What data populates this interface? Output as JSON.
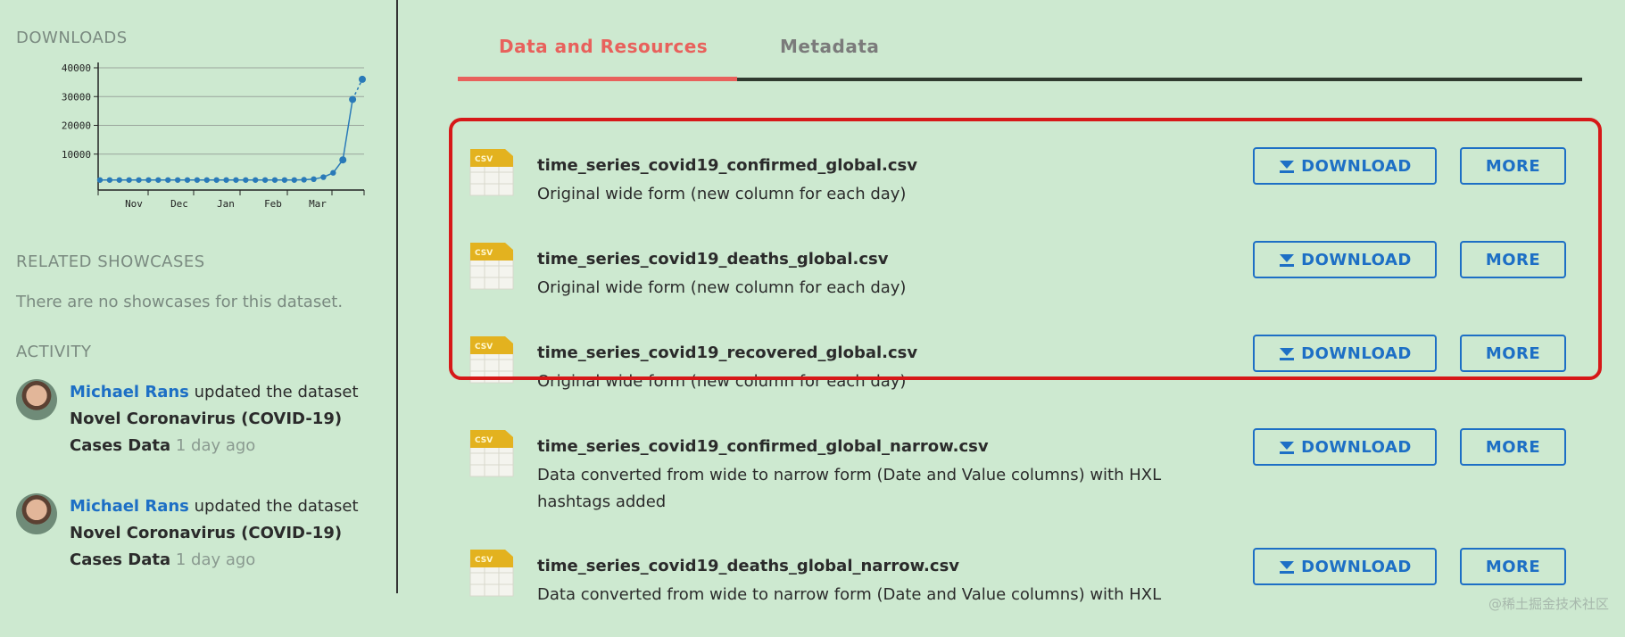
{
  "sidebar": {
    "downloads_title": "DOWNLOADS",
    "related_title": "RELATED SHOWCASES",
    "no_showcases": "There are no showcases for this dataset.",
    "activity_title": "ACTIVITY",
    "activity": [
      {
        "user": "Michael Rans",
        "action": " updated the dataset ",
        "dataset": "Novel Coronavirus (COVID-19) Cases Data",
        "time": "1 day ago"
      },
      {
        "user": "Michael Rans",
        "action": " updated the dataset ",
        "dataset": "Novel Coronavirus (COVID-19) Cases Data",
        "time": "1 day ago"
      }
    ]
  },
  "chart_data": {
    "type": "line",
    "title": "",
    "xlabel": "",
    "ylabel": "",
    "y_ticks": [
      "40000",
      "30000",
      "20000",
      "10000"
    ],
    "x_ticks": [
      "Nov",
      "Dec",
      "Jan",
      "Feb",
      "Mar"
    ],
    "ylim": [
      0,
      40000
    ],
    "grid": true,
    "values": [
      1000,
      1000,
      1000,
      1000,
      1000,
      1000,
      1000,
      1000,
      1000,
      1000,
      1000,
      1000,
      1000,
      1000,
      1000,
      1000,
      1000,
      1000,
      1000,
      1000,
      1000,
      1100,
      1300,
      2000,
      3500,
      8000,
      29000,
      36000
    ],
    "last_point_dashed": true,
    "color": "#2a7ab8"
  },
  "tabs": {
    "active": "Data and Resources",
    "inactive": "Metadata"
  },
  "colors": {
    "accent": "#e8615c",
    "link": "#1d6fc5",
    "highlight": "#d61818",
    "background": "#cde9d0"
  },
  "resources": [
    {
      "name": "time_series_covid19_confirmed_global.csv",
      "desc": "Original wide form (new column for each day)",
      "icon_label": "CSV"
    },
    {
      "name": "time_series_covid19_deaths_global.csv",
      "desc": "Original wide form (new column for each day)",
      "icon_label": "CSV"
    },
    {
      "name": "time_series_covid19_recovered_global.csv",
      "desc": "Original wide form (new column for each day)",
      "icon_label": "CSV"
    },
    {
      "name": "time_series_covid19_confirmed_global_narrow.csv",
      "desc": "Data converted from wide to narrow form (Date and Value columns) with HXL hashtags added",
      "icon_label": "CSV"
    },
    {
      "name": "time_series_covid19_deaths_global_narrow.csv",
      "desc": "Data converted from wide to narrow form (Date and Value columns) with HXL",
      "icon_label": "CSV"
    }
  ],
  "buttons": {
    "download": "DOWNLOAD",
    "more": "MORE"
  },
  "watermark": "@稀土掘金技术社区"
}
